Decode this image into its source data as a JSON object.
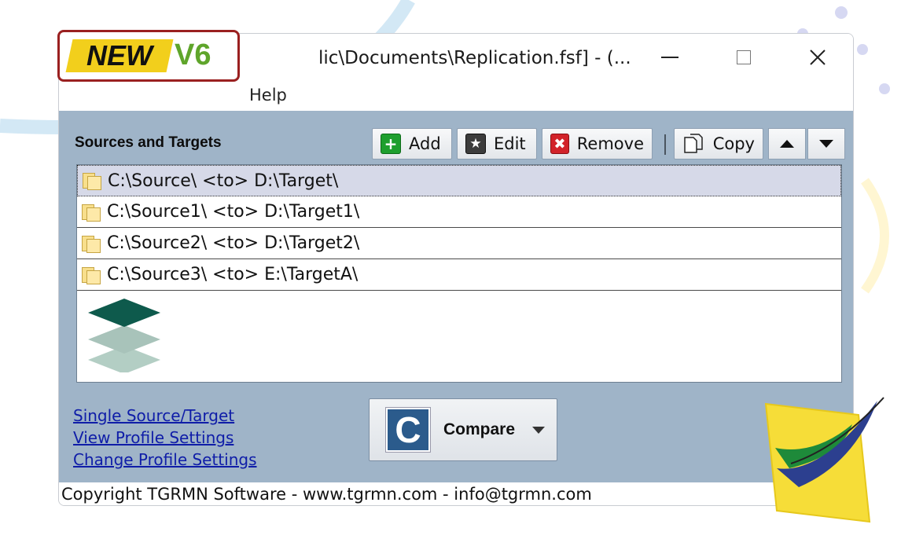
{
  "badge": {
    "new_label": "NEW",
    "version_label": "V6"
  },
  "window": {
    "title": "lic\\Documents\\Replication.fsf] - (...",
    "menu_help": "Help"
  },
  "sources": {
    "section_label": "Sources and Targets",
    "toolbar": {
      "add_label": "Add",
      "edit_label": "Edit",
      "remove_label": "Remove",
      "copy_label": "Copy"
    },
    "rows": [
      "C:\\Source\\ <to> D:\\Target\\",
      "C:\\Source1\\ <to> D:\\Target1\\",
      "C:\\Source2\\ <to> D:\\Target2\\",
      "C:\\Source3\\ <to> E:\\TargetA\\"
    ]
  },
  "links": {
    "single": "Single Source/Target",
    "view": "View Profile Settings",
    "change": "Change Profile Settings"
  },
  "compare": {
    "icon_letter": "C",
    "label": "Compare"
  },
  "status": {
    "text": "Copyright TGRMN Software - www.tgrmn.com - info@tgrmn.com"
  },
  "colors": {
    "client_bg": "#9fb4c8",
    "accent_green": "#1e9f2e",
    "link": "#0f1da8",
    "badge_yellow": "#f2cf1c"
  }
}
